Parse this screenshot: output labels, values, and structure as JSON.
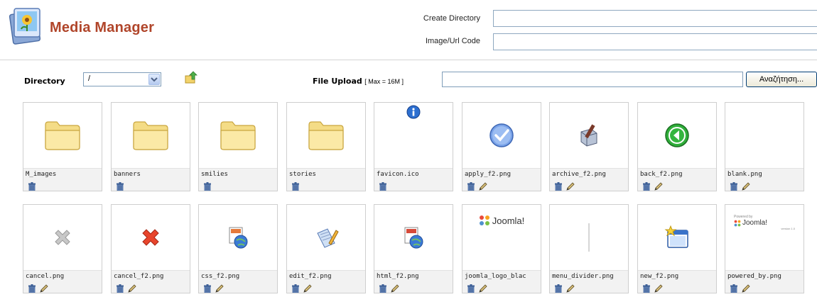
{
  "header": {
    "title": "Media Manager",
    "create_directory_label": "Create Directory",
    "image_url_code_label": "Image/Url Code",
    "create_directory_value": "",
    "image_url_code_value": ""
  },
  "toolbar": {
    "directory_label": "Directory",
    "directory_value": "/",
    "upload_label": "File Upload",
    "upload_max": "[ Max = 16M ]",
    "browse_label": "Αναζήτηση..."
  },
  "files": [
    {
      "name": "M_images",
      "kind": "folder",
      "icon": "folder-icon",
      "editable": false
    },
    {
      "name": "banners",
      "kind": "folder",
      "icon": "folder-icon",
      "editable": false
    },
    {
      "name": "smilies",
      "kind": "folder",
      "icon": "folder-icon",
      "editable": false
    },
    {
      "name": "stories",
      "kind": "folder",
      "icon": "folder-icon",
      "editable": false
    },
    {
      "name": "favicon.ico",
      "kind": "file",
      "icon": "info-icon",
      "editable": false
    },
    {
      "name": "apply_f2.png",
      "kind": "file",
      "icon": "apply-check-icon",
      "editable": true
    },
    {
      "name": "archive_f2.png",
      "kind": "file",
      "icon": "archive-box-icon",
      "editable": true
    },
    {
      "name": "back_f2.png",
      "kind": "file",
      "icon": "back-arrow-icon",
      "editable": true
    },
    {
      "name": "blank.png",
      "kind": "file",
      "icon": "blank-icon",
      "editable": true
    },
    {
      "name": "cancel.png",
      "kind": "file",
      "icon": "cancel-gray-x-icon",
      "editable": true
    },
    {
      "name": "cancel_f2.png",
      "kind": "file",
      "icon": "cancel-red-x-icon",
      "editable": true
    },
    {
      "name": "css_f2.png",
      "kind": "file",
      "icon": "css-globe-icon",
      "editable": true
    },
    {
      "name": "edit_f2.png",
      "kind": "file",
      "icon": "edit-pencil-icon",
      "editable": true
    },
    {
      "name": "html_f2.png",
      "kind": "file",
      "icon": "html-globe-icon",
      "editable": true
    },
    {
      "name": "joomla_logo_blac",
      "kind": "file",
      "icon": "joomla-logo-icon",
      "editable": true
    },
    {
      "name": "menu_divider.png",
      "kind": "file",
      "icon": "menu-divider-icon",
      "editable": true
    },
    {
      "name": "new_f2.png",
      "kind": "file",
      "icon": "new-window-star-icon",
      "editable": true
    },
    {
      "name": "powered_by.png",
      "kind": "file",
      "icon": "powered-by-joomla-icon",
      "editable": true
    }
  ],
  "logo_text": {
    "joomla": "Joomla!",
    "powered_by": "Powered by",
    "version": "version 1.0"
  },
  "colors": {
    "title": "#b0452a",
    "tile_border": "#cfcfcf",
    "meta_bg": "#f2f2f2"
  }
}
